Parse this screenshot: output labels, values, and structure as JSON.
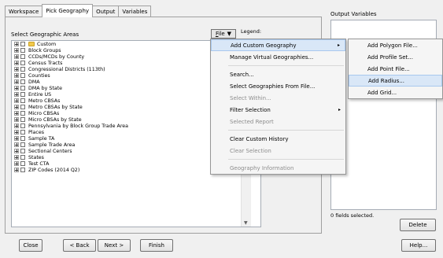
{
  "tabs": [
    "Workspace",
    "Pick Geography",
    "Output",
    "Variables"
  ],
  "active_tab": "Pick Geography",
  "select_label": "Select Geographic Areas",
  "file_button": {
    "label_underlined": "F",
    "label_rest": "ile",
    "arrow": "▼"
  },
  "legend_label": "Legend:",
  "tree_items": [
    "Custom",
    "Block Groups",
    "CCDs/MCDs by County",
    "Census Tracts",
    "Congressional Districts (113th)",
    "Counties",
    "DMA",
    "DMA by State",
    "Entire US",
    "Metro CBSAs",
    "Metro CBSAs by State",
    "Micro CBSAs",
    "Micro CBSAs by State",
    "Pennsylvania by Block Group Trade Area",
    "Places",
    "Sample TA",
    "Sample Trade Area",
    "Sectional Centers",
    "States",
    "Test CTA",
    "ZIP Codes (2014 Q2)"
  ],
  "output_label": "Output Variables",
  "fields_selected": "0 fields selected.",
  "buttons": {
    "delete": "Delete",
    "close": "Close",
    "back": "< Back",
    "next": "Next >",
    "finish": "Finish",
    "help": "Help..."
  },
  "file_menu": [
    {
      "label": "Add Custom Geography",
      "submenu": true,
      "highlight": true
    },
    {
      "label": "Manage Virtual Geographies..."
    },
    {
      "sep": true
    },
    {
      "label": "Search..."
    },
    {
      "label": "Select Geographies From File..."
    },
    {
      "label": "Select Within...",
      "disabled": true
    },
    {
      "label": "Filter Selection",
      "submenu": true
    },
    {
      "label": "Selected Report",
      "disabled": true
    },
    {
      "sep": true
    },
    {
      "label": "Clear Custom History"
    },
    {
      "label": "Clear Selection",
      "disabled": true
    },
    {
      "sep": true
    },
    {
      "label": "Geography Information",
      "disabled": true
    }
  ],
  "submenu": [
    {
      "label": "Add Polygon File..."
    },
    {
      "label": "Add Profile Set..."
    },
    {
      "label": "Add Point File..."
    },
    {
      "label": "Add Radius...",
      "highlight": true
    },
    {
      "label": "Add Grid..."
    }
  ],
  "icons": {
    "expand": "plus-box-icon",
    "checkbox": "checkbox-icon",
    "folder": "folder-icon",
    "submenu_arrow": "▸",
    "scroll_down": "▼"
  },
  "colors": {
    "menu_highlight": "#d9e7f7",
    "disabled_text": "#8d8d8d",
    "folder": "#f2c94c"
  }
}
